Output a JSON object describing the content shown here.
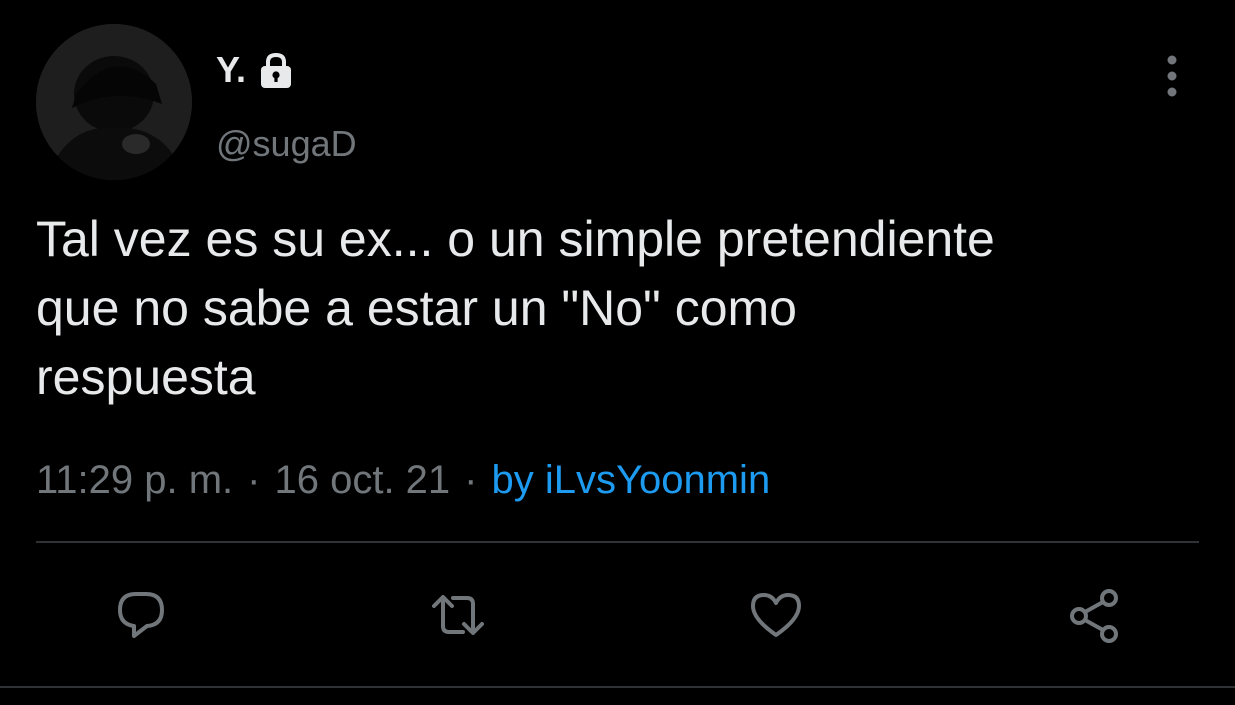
{
  "author": {
    "display_name": "Y.",
    "handle": "@sugaD",
    "avatar_icon": "avatar-photo",
    "protected_icon": "lock-icon"
  },
  "tweet": {
    "text": "Tal vez es su ex... o un simple pretendiente\nque no sabe a estar un \"No\" como\nrespuesta"
  },
  "meta": {
    "time": "11:29 p. m.",
    "separator_1": "·",
    "date": "16 oct. 21",
    "separator_2": "·",
    "source": "by iLvsYoonmin"
  },
  "actions": {
    "reply_icon": "reply-icon",
    "retweet_icon": "retweet-icon",
    "like_icon": "heart-icon",
    "share_icon": "share-icon"
  },
  "colors": {
    "background": "#000000",
    "text_primary": "#e7e9ea",
    "text_secondary": "#71767b",
    "link": "#1d9bf0",
    "divider": "#2f3336"
  }
}
